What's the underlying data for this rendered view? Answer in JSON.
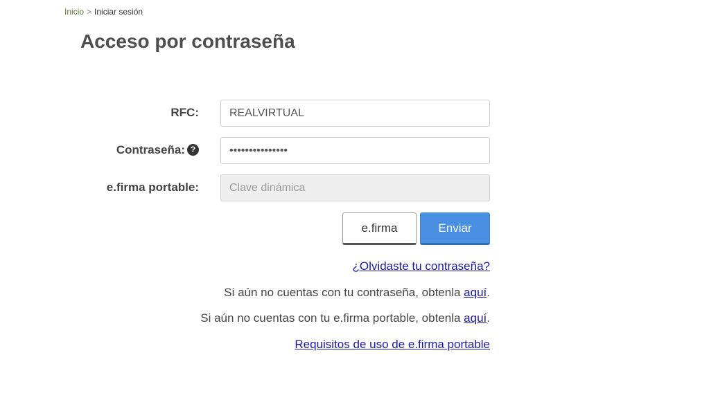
{
  "breadcrumb": {
    "home": "Inicio",
    "separator": ">",
    "current": "Iniciar sesión"
  },
  "page_title": "Acceso por contraseña",
  "form": {
    "rfc_label": "RFC:",
    "rfc_value": "REALVIRTUAL",
    "password_label": "Contraseña:",
    "password_help_icon": "question-circle-icon",
    "password_value": "•••••••••••••••",
    "efirma_label": "e.firma portable:",
    "efirma_placeholder": "Clave dinámica"
  },
  "buttons": {
    "efirma": "e.firma",
    "submit": "Enviar"
  },
  "links": {
    "forgot_password": "¿Olvidaste tu contraseña?",
    "no_password_text": "Si aún no cuentas con tu contraseña, obtenla ",
    "no_password_link": "aquí",
    "no_efirma_text": "Si aún no cuentas con tu e.firma portable, obtenla ",
    "no_efirma_link": "aquí",
    "period": ".",
    "requirements": "Requisitos de uso de e.firma portable"
  },
  "colors": {
    "primary_button": "#4a90e2",
    "link": "#1a1aa8",
    "breadcrumb_link": "#5a7a3a"
  }
}
